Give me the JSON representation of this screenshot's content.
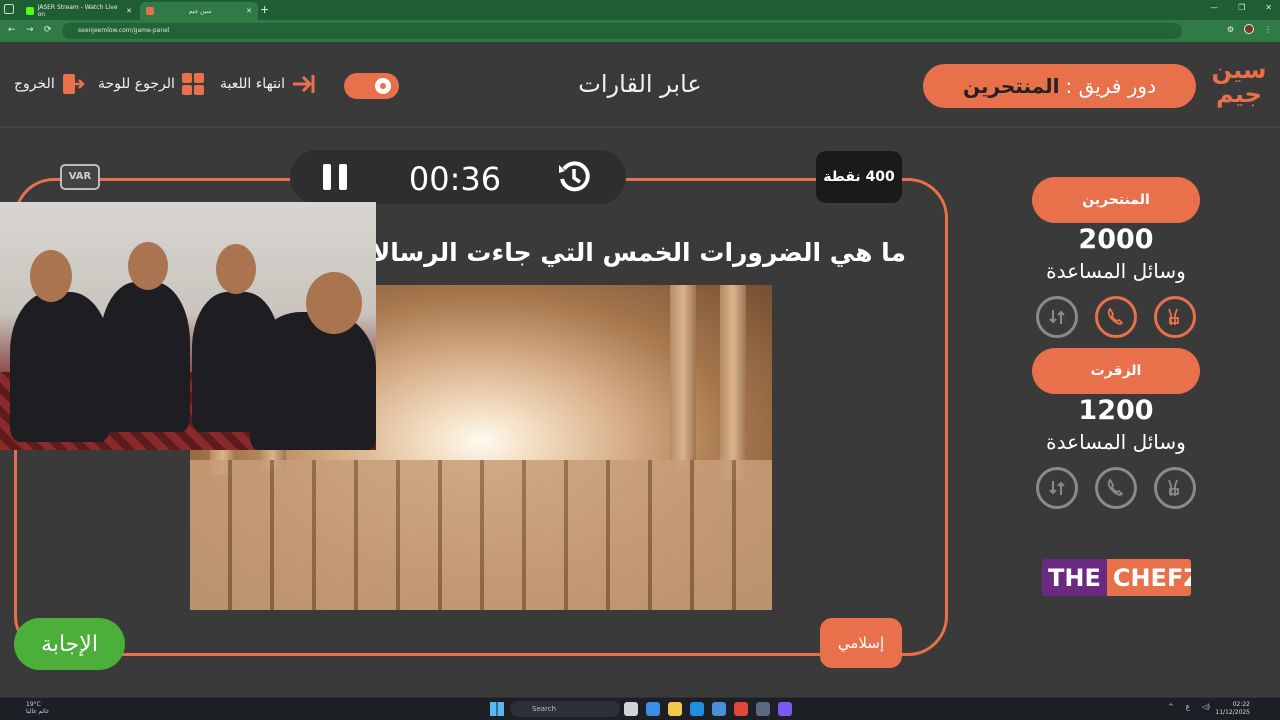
{
  "browser": {
    "tabs": [
      {
        "title": "JASER Stream - Watch Live on",
        "favicon_color": "#53fc18"
      },
      {
        "title": "سين جيم",
        "favicon_color": "#e8704a"
      }
    ],
    "url": "seenjeemlow.com/game-panel"
  },
  "header": {
    "exit_label": "الخروج",
    "back_to_board_label": "الرجوع للوحة",
    "end_game_label": "انتهاء اللعبة",
    "game_title": "عابر القارات",
    "turn_label": "دور فريق :",
    "turn_team": "المنتحرين",
    "logo_text": "سين جيم"
  },
  "question": {
    "timer": "00:36",
    "points": "400 نقطة",
    "var_label": "VAR",
    "text": "ما هي الضرورات الخمس التي جاءت الرسالات ا",
    "category": "إسلامي",
    "answer_label": "الإجابة"
  },
  "teams": [
    {
      "name": "المنتحرين",
      "score": "2000",
      "helps_label": "وسائل المساعدة",
      "active": true
    },
    {
      "name": "الزقرت",
      "score": "1200",
      "helps_label": "وسائل المساعدة",
      "active": false
    }
  ],
  "sponsor": {
    "part1": "THE",
    "part2": "CHEFZ"
  },
  "taskbar": {
    "weather_temp": "19°C",
    "weather_desc": "غائم غالبا",
    "search_placeholder": "Search",
    "time": "02:22",
    "date": "11/12/2025",
    "lang": "ع"
  },
  "colors": {
    "accent": "#e8704a",
    "answer": "#4caf3a",
    "background": "#3a3a3a"
  }
}
